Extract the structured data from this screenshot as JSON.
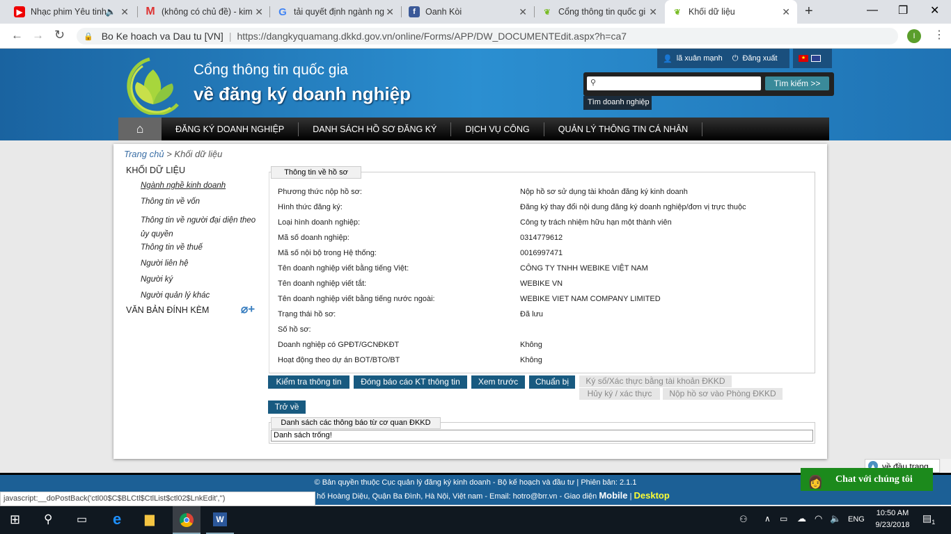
{
  "browser": {
    "tabs": [
      {
        "label": "Nhạc phim Yêu tinh",
        "icon": "youtube-icon"
      },
      {
        "label": "(không có chủ đề) - kim",
        "icon": "gmail-icon"
      },
      {
        "label": "tải quyết định ngành ng",
        "icon": "google-icon"
      },
      {
        "label": "Oanh Kòi",
        "icon": "facebook-icon"
      },
      {
        "label": "Cổng thông tin quốc gi",
        "icon": "leaf-icon"
      },
      {
        "label": "Khối dữ liệu",
        "icon": "leaf-icon"
      }
    ],
    "site_label": "Bo Ke hoach va Dau tu [VN]",
    "url": "https://dangkyquamang.dkkd.gov.vn/online/Forms/APP/DW_DOCUMENTEdit.aspx?h=ca7",
    "profile_initial": "I"
  },
  "header": {
    "title1": "Cổng thông tin quốc gia",
    "title2": "về đăng ký doanh nghiệp",
    "user": "lã xuân mạnh",
    "logout": "Đăng xuất",
    "search_placeholder": "",
    "search_button": "Tìm kiếm >>",
    "search_hint": "Tìm doanh nghiệp"
  },
  "nav": [
    "ĐĂNG KÝ DOANH NGHIỆP",
    "DANH SÁCH HỒ SƠ ĐĂNG KÝ",
    "DỊCH VỤ CÔNG",
    "QUẢN LÝ THÔNG TIN CÁ NHÂN"
  ],
  "breadcrumb": {
    "home": "Trang chủ",
    "sep": ">",
    "current": "Khối dữ liệu"
  },
  "sidebar": {
    "heading": "KHỐI DỮ LIỆU",
    "items": [
      "Ngành nghề kinh doanh",
      "Thông tin về vốn",
      "Thông tin về người đại diện theo ủy quyền",
      "Thông tin về thuế",
      "Người liên hệ",
      "Người ký",
      "Người quản lý khác"
    ],
    "attach_heading": "VĂN BẢN ĐÍNH KÈM"
  },
  "info": {
    "legend": "Thông tin về hồ sơ",
    "rows": [
      {
        "label": "Phương thức nộp hồ sơ:",
        "value": "Nộp hồ sơ sử dụng tài khoản đăng ký kinh doanh"
      },
      {
        "label": "Hình thức đăng ký:",
        "value": "Đăng ký thay đổi nội dung đăng ký doanh nghiệp/đơn vị trực thuộc"
      },
      {
        "label": "Loại hình doanh nghiệp:",
        "value": "Công ty trách nhiệm hữu hạn một thành viên"
      },
      {
        "label": "Mã số doanh nghiệp:",
        "value": "0314779612"
      },
      {
        "label": "Mã số nội bộ trong Hệ thống:",
        "value": "0016997471"
      },
      {
        "label": "Tên doanh nghiệp viết bằng tiếng Việt:",
        "value": "CÔNG TY TNHH WEBIKE VIỆT NAM"
      },
      {
        "label": "Tên doanh nghiệp viết tắt:",
        "value": "WEBIKE VN"
      },
      {
        "label": "Tên doanh nghiệp viết bằng tiếng nước ngoài:",
        "value": "WEBIKE VIET NAM COMPANY LIMITED"
      },
      {
        "label": "Trạng thái hồ sơ:",
        "value": "Đã lưu"
      },
      {
        "label": "Số hồ sơ:",
        "value": ""
      },
      {
        "label": "Doanh nghiệp có GPĐT/GCNĐKĐT",
        "value": "Không"
      },
      {
        "label": "Hoạt động theo dự án BOT/BTO/BT",
        "value": "Không"
      }
    ]
  },
  "buttons": {
    "check": "Kiểm tra thông tin",
    "close_report": "Đóng báo cáo KT thông tin",
    "preview": "Xem trước",
    "prepare": "Chuẩn bị",
    "sign": "Ký số/Xác thực bằng tài khoản ĐKKD",
    "cancel_sign": "Hủy ký / xác thực",
    "submit": "Nộp hồ sơ vào Phòng ĐKKD",
    "back": "Trở về"
  },
  "notices": {
    "legend": "Danh sách các thông báo từ cơ quan ĐKKD",
    "empty": "Danh sách trống!"
  },
  "back_to_top": "về đầu trang",
  "chat": "Chat với chúng tôi",
  "footer": {
    "line1": "© Bản quyền thuộc Cục quản lý đăng ký kinh doanh - Bộ kế hoạch và đầu tư | Phiên bản: 2.1.1",
    "line2": "hố Hoàng Diệu, Quận Ba Đình, Hà Nội, Việt nam - Email: hotro@brr.vn - Giao diện",
    "mobile": "Mobile",
    "sep": "|",
    "desktop": "Desktop"
  },
  "status_bar": "javascript:__doPostBack('ctl00$C$BLCtl$CtlList$ctl02$LnkEdit','')",
  "taskbar": {
    "lang": "ENG",
    "time": "10:50 AM",
    "date": "9/23/2018",
    "notifications": "1"
  }
}
